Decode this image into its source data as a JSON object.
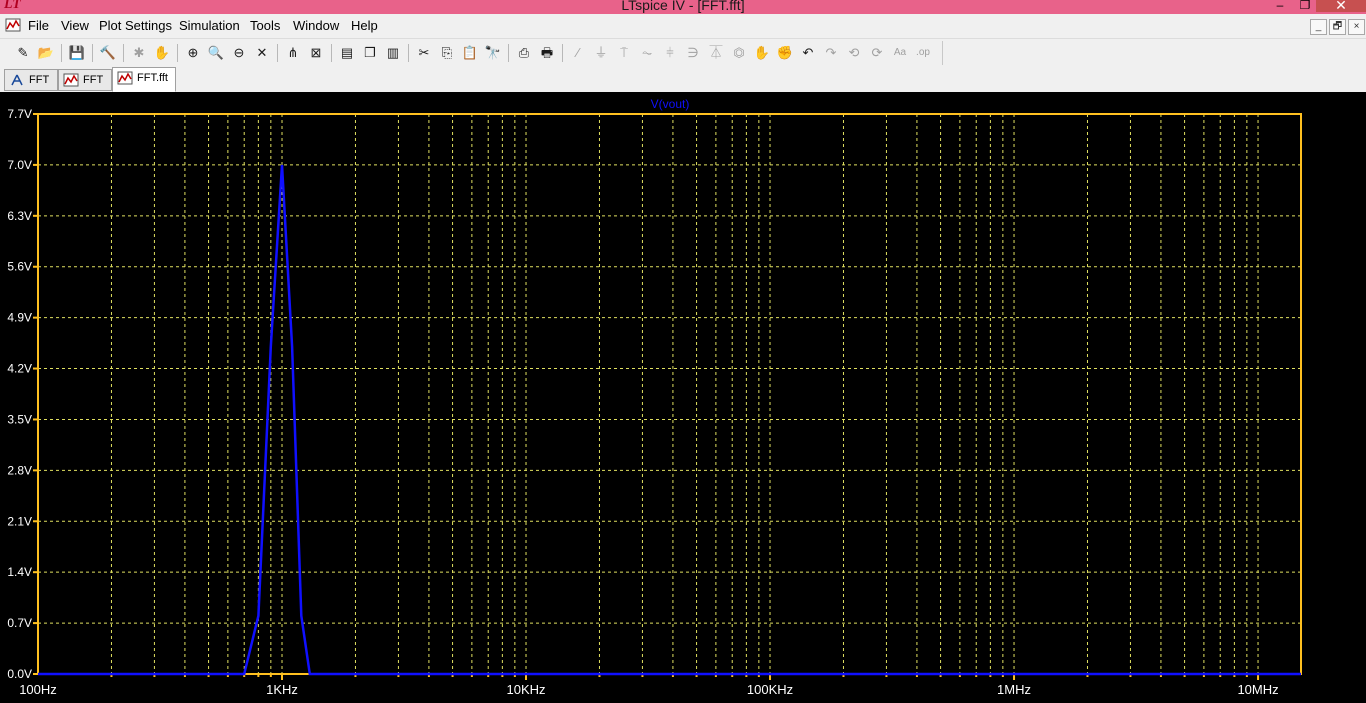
{
  "window": {
    "title": "LTspice IV - [FFT.fft]",
    "app_icon": "LT",
    "controls": {
      "minimize": "–",
      "restore": "❐",
      "close": "✕"
    }
  },
  "menu": {
    "items": [
      "File",
      "View",
      "Plot Settings",
      "Simulation",
      "Tools",
      "Window",
      "Help"
    ],
    "mdi_controls": {
      "minimize": "_",
      "restore": "🗗",
      "close": "×"
    }
  },
  "toolbar": {
    "buttons": [
      {
        "icon": "new-schematic-icon",
        "glyph": "✎",
        "enabled": true
      },
      {
        "icon": "open-icon",
        "glyph": "📂",
        "enabled": true
      },
      {
        "icon": "save-icon",
        "glyph": "💾",
        "enabled": true
      },
      {
        "icon": "control-panel-icon",
        "glyph": "🔨",
        "enabled": true
      },
      {
        "icon": "run-icon",
        "glyph": "✱",
        "enabled": false
      },
      {
        "icon": "pan-icon",
        "glyph": "✋",
        "enabled": false
      },
      {
        "icon": "zoom-in-icon",
        "glyph": "⊕",
        "enabled": true
      },
      {
        "icon": "zoom-area-icon",
        "glyph": "🔍",
        "enabled": true
      },
      {
        "icon": "zoom-out-icon",
        "glyph": "⊖",
        "enabled": true
      },
      {
        "icon": "zoom-fit-icon",
        "glyph": "✕",
        "enabled": true
      },
      {
        "icon": "autorange-icon",
        "glyph": "⋔",
        "enabled": true
      },
      {
        "icon": "delete-trace-icon",
        "glyph": "⊠",
        "enabled": true
      },
      {
        "icon": "tile-horizontal-icon",
        "glyph": "▤",
        "enabled": true
      },
      {
        "icon": "cascade-icon",
        "glyph": "❐",
        "enabled": true
      },
      {
        "icon": "tile-vertical-icon",
        "glyph": "▥",
        "enabled": true
      },
      {
        "icon": "cut-icon",
        "glyph": "✂",
        "enabled": true
      },
      {
        "icon": "copy-icon",
        "glyph": "⎘",
        "enabled": true
      },
      {
        "icon": "paste-icon",
        "glyph": "📋",
        "enabled": true
      },
      {
        "icon": "find-icon",
        "glyph": "🔭",
        "enabled": true
      },
      {
        "icon": "print-preview-icon",
        "glyph": "⎙",
        "enabled": true
      },
      {
        "icon": "print-icon",
        "glyph": "🖶",
        "enabled": true
      },
      {
        "icon": "wire-icon",
        "glyph": "∕",
        "enabled": false
      },
      {
        "icon": "ground-icon",
        "glyph": "⏚",
        "enabled": false
      },
      {
        "icon": "label-net-icon",
        "glyph": "⍑",
        "enabled": false
      },
      {
        "icon": "resistor-icon",
        "glyph": "⏦",
        "enabled": false
      },
      {
        "icon": "capacitor-icon",
        "glyph": "⫩",
        "enabled": false
      },
      {
        "icon": "inductor-icon",
        "glyph": "∋",
        "enabled": false
      },
      {
        "icon": "diode-icon",
        "glyph": "⏄",
        "enabled": false
      },
      {
        "icon": "component-icon",
        "glyph": "⏣",
        "enabled": false
      },
      {
        "icon": "move-icon",
        "glyph": "✋",
        "enabled": false
      },
      {
        "icon": "drag-icon",
        "glyph": "✊",
        "enabled": false
      },
      {
        "icon": "undo-icon",
        "glyph": "↶",
        "enabled": true
      },
      {
        "icon": "redo-icon",
        "glyph": "↷",
        "enabled": false
      },
      {
        "icon": "rotate-icon",
        "glyph": "⟲",
        "enabled": false
      },
      {
        "icon": "mirror-icon",
        "glyph": "⟳",
        "enabled": false
      },
      {
        "icon": "text-icon",
        "glyph": "Aa",
        "enabled": false
      },
      {
        "icon": "spice-directive-icon",
        "glyph": ".op",
        "enabled": false
      }
    ]
  },
  "tabs": [
    {
      "label": "FFT",
      "icon": "schematic-icon",
      "active": false
    },
    {
      "label": "FFT",
      "icon": "waveform-icon",
      "active": false
    },
    {
      "label": "FFT.fft",
      "icon": "waveform-icon",
      "active": true
    }
  ],
  "colors": {
    "plot_bg": "#000000",
    "axis": "#ffc020",
    "grid": "#e0e060",
    "trace": "#1010ff",
    "tick_label": "#ffffff"
  },
  "chart_data": {
    "type": "line",
    "title": "",
    "xlabel": "",
    "ylabel": "",
    "x_scale": "log",
    "xlim": [
      100,
      15000000
    ],
    "ylim": [
      0,
      7.7
    ],
    "grid": true,
    "x_tick_labels": [
      "100Hz",
      "1KHz",
      "10KHz",
      "100KHz",
      "1MHz",
      "10MHz"
    ],
    "x_ticks": [
      100,
      1000,
      10000,
      100000,
      1000000,
      10000000
    ],
    "y_tick_labels": [
      "0.0V",
      "0.7V",
      "1.4V",
      "2.1V",
      "2.8V",
      "3.5V",
      "4.2V",
      "4.9V",
      "5.6V",
      "6.3V",
      "7.0V",
      "7.7V"
    ],
    "y_ticks": [
      0,
      0.7,
      1.4,
      2.1,
      2.8,
      3.5,
      4.2,
      4.9,
      5.6,
      6.3,
      7.0,
      7.7
    ],
    "series": [
      {
        "name": "V(vout)",
        "x": [
          100,
          400,
          700,
          800,
          900,
          1000,
          1100,
          1200,
          1300,
          5000,
          50000,
          500000,
          5000000,
          15000000
        ],
        "y": [
          0,
          0,
          0,
          0.8,
          4.5,
          7.0,
          4.5,
          0.8,
          0,
          0,
          0,
          0,
          0,
          0
        ]
      }
    ]
  }
}
